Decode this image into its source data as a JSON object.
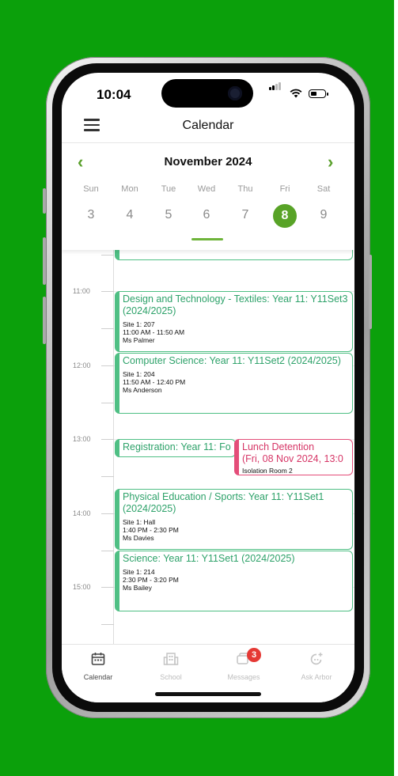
{
  "status_bar": {
    "time": "10:04"
  },
  "header": {
    "title": "Calendar"
  },
  "week": {
    "month": "November 2024",
    "prev_icon": "‹",
    "next_icon": "›",
    "day_names": [
      "Sun",
      "Mon",
      "Tue",
      "Wed",
      "Thu",
      "Fri",
      "Sat"
    ],
    "day_numbers": [
      "3",
      "4",
      "5",
      "6",
      "7",
      "8",
      "9"
    ],
    "selected_day": "8"
  },
  "timeline": {
    "times": [
      "11:00",
      "12:00",
      "13:00",
      "14:00",
      "15:00"
    ],
    "events": [
      {
        "title": "Design and Technology - Textiles: Year 11: Y11Set3 (2024/2025)",
        "location": "Site 1: 207",
        "time_range": "11:00 AM - 11:50 AM",
        "teacher": "Ms Palmer"
      },
      {
        "title": "Computer Science: Year 11: Y11Set2 (2024/2025)",
        "location": "Site 1: 204",
        "time_range": "11:50 AM - 12:40 PM",
        "teacher": "Ms Anderson"
      },
      {
        "title": "Registration: Year 11: Fo"
      },
      {
        "title": "Lunch Detention",
        "subtitle": "(Fri, 08 Nov 2024, 13:0",
        "location": "Isolation Room 2"
      },
      {
        "title": "Physical Education / Sports: Year 11: Y11Set1 (2024/2025)",
        "location": "Site 1: Hall",
        "time_range": "1:40 PM - 2:30 PM",
        "teacher": "Ms Davies"
      },
      {
        "title": "Science: Year 11: Y11Set1 (2024/2025)",
        "location": "Site 1: 214",
        "time_range": "2:30 PM - 3:20 PM",
        "teacher": "Ms Bailey"
      }
    ]
  },
  "tabbar": {
    "tabs": [
      {
        "label": "Calendar",
        "icon": "calendar-icon",
        "active": true
      },
      {
        "label": "School",
        "icon": "school-icon",
        "active": false
      },
      {
        "label": "Messages",
        "icon": "messages-icon",
        "active": false,
        "badge": "3"
      },
      {
        "label": "Ask Arbor",
        "icon": "ask-arbor-icon",
        "active": false
      }
    ]
  },
  "colors": {
    "background": "#0ba00b",
    "accent": "#58a327",
    "event_green": "#4fbf84",
    "event_pink": "#e44d79",
    "badge": "#e53935"
  }
}
